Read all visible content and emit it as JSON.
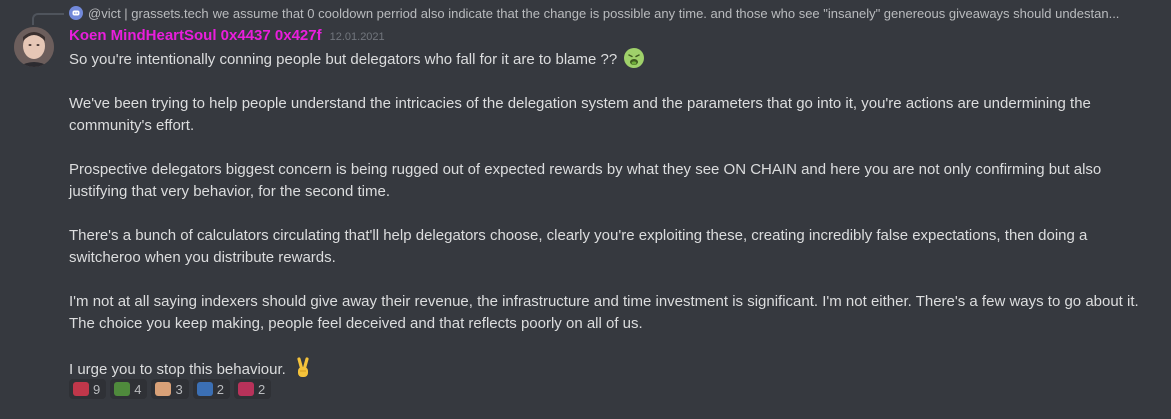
{
  "reply": {
    "author": "@vict | grassets.tech",
    "text": "we assume that 0 cooldown perriod also indicate that the change is possible any time. and those who see \"insanely\" genereous giveaways should undestan..."
  },
  "author": {
    "name": "Koen MindHeartSoul 0x4437 0x427f",
    "timestamp": "12.01.2021"
  },
  "paragraphs": [
    "So you're intentionally conning people but delegators who fall for it are to blame ??",
    "We've been trying to help people understand the intricacies of the delegation system and the parameters that go into it, you're actions are undermining the community's effort.",
    "Prospective delegators biggest concern is being rugged out of expected rewards by what they see ON CHAIN and here you are not only confirming but also justifying that very behavior, for the second time.",
    "There's a bunch of calculators circulating that'll help delegators choose, clearly you're exploiting these, creating incredibly false expectations, then doing a switcheroo when you distribute rewards.",
    "I'm not at all saying indexers should give away their revenue, the infrastructure and time investment is significant.  I'm not either.  There's a few ways to go about it.  The choice you keep making, people feel deceived and that reflects poorly on all of us.",
    "I urge you to stop this behaviour."
  ],
  "emojis": {
    "first_paragraph": "nauseated-face-icon",
    "last_paragraph": "victory-hand-icon"
  },
  "reactions": [
    {
      "icon": "red-custom-emoji-icon",
      "color": "#c0374a",
      "count": "9"
    },
    {
      "icon": "pepe-frog-icon",
      "color": "#4f8a3c",
      "count": "4"
    },
    {
      "icon": "face-emoji-icon",
      "color": "#d9a178",
      "count": "3"
    },
    {
      "icon": "pog-emoji-icon",
      "color": "#3b6fb4",
      "count": "2"
    },
    {
      "icon": "pink-custom-emoji-icon",
      "color": "#b8325a",
      "count": "2"
    }
  ]
}
